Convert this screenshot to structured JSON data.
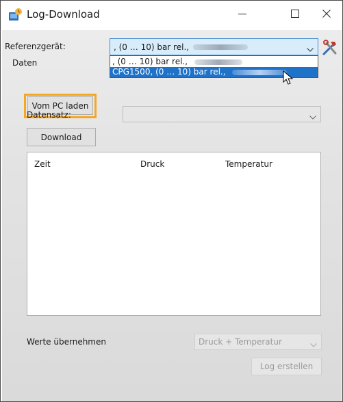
{
  "window": {
    "title": "Log-Download",
    "icons": {
      "app": "app-icon",
      "minimize": "minimize-icon",
      "maximize": "maximize-icon",
      "close": "close-icon"
    }
  },
  "reference": {
    "label": "Referenzgerät:",
    "selected_value": ", (0 … 10) bar rel.,",
    "options": [
      ", (0 … 10) bar rel.,",
      "CPG1500, (0 … 10) bar rel.,"
    ],
    "highlighted_option_index": 1,
    "tools_icon": "tools-icon"
  },
  "data_group": {
    "label": "Daten",
    "load_button": "Vom PC laden",
    "datensatz_label": "Datensatz:",
    "datensatz_value": "",
    "download_button": "Download"
  },
  "table": {
    "columns": [
      "Zeit",
      "Druck",
      "Temperatur"
    ],
    "rows": []
  },
  "footer": {
    "werte_label": "Werte übernehmen",
    "werte_value": "Druck + Temperatur",
    "log_button": "Log erstellen"
  },
  "colors": {
    "selection_blue": "#1e72c8",
    "highlight_orange": "#f5a623",
    "combo_focus": "#d9ecfa"
  }
}
